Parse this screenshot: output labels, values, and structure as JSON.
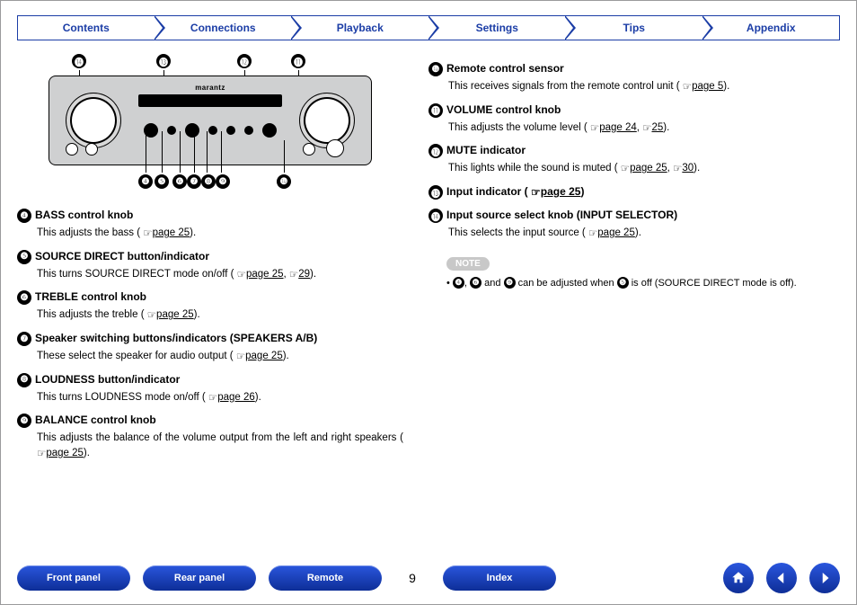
{
  "tabs": [
    "Contents",
    "Connections",
    "Playback",
    "Settings",
    "Tips",
    "Appendix"
  ],
  "callouts": {
    "top": [
      "⓮",
      "⓭",
      "⓬",
      "⓫"
    ],
    "bottom": [
      "❹",
      "❺",
      "❻",
      "❼",
      "❽",
      "❾",
      "❿"
    ]
  },
  "diagram": {
    "brand": "marantz"
  },
  "left": [
    {
      "num": "❹",
      "title": "BASS control knob",
      "body": "This adjusts the bass (",
      "links": [
        "page 25"
      ],
      "after": ")."
    },
    {
      "num": "❺",
      "title": "SOURCE DIRECT button/indicator",
      "body": "This turns SOURCE DIRECT mode on/off (",
      "links": [
        "page 25",
        "29"
      ],
      "after": ")."
    },
    {
      "num": "❻",
      "title": "TREBLE control knob",
      "body": "This adjusts the treble (",
      "links": [
        "page 25"
      ],
      "after": ")."
    },
    {
      "num": "❼",
      "title": "Speaker switching buttons/indicators (SPEAKERS A/B)",
      "body": "These select the speaker for audio output (",
      "links": [
        "page 25"
      ],
      "after": ")."
    },
    {
      "num": "❽",
      "title": "LOUDNESS button/indicator",
      "body": "This turns LOUDNESS mode on/off (",
      "links": [
        "page 26"
      ],
      "after": ")."
    },
    {
      "num": "❾",
      "title": "BALANCE control knob",
      "body": "This adjusts the balance of the volume output from the left and right speakers (",
      "links": [
        "page 25"
      ],
      "after": ")."
    }
  ],
  "right": [
    {
      "num": "❿",
      "title": "Remote control sensor",
      "body": "This receives signals from the remote control unit (",
      "links": [
        "page 5"
      ],
      "after": ")."
    },
    {
      "num": "⓫",
      "title": "VOLUME control knob",
      "body": "This adjusts the volume level (",
      "links": [
        "page 24",
        "25"
      ],
      "after": ")."
    },
    {
      "num": "⓬",
      "title": "MUTE indicator",
      "body": "This lights while the sound is muted (",
      "links": [
        "page 25",
        "30"
      ],
      "after": ")."
    },
    {
      "num": "⓭",
      "title": "Input indicator (",
      "body": "",
      "links": [
        "page 25"
      ],
      "after": ")",
      "titleHasLink": true
    },
    {
      "num": "⓮",
      "title": "Input source select knob (INPUT SELECTOR)",
      "body": "This selects the input source (",
      "links": [
        "page 25"
      ],
      "after": ")."
    }
  ],
  "noteLabel": "NOTE",
  "noteBullet": {
    "pre": "• ",
    "a": "❹",
    "b": "❻",
    "c": "❾",
    "d": "❺",
    "mid1": ", ",
    "mid2": " and ",
    "mid3": " can be adjusted when ",
    "mid4": " is off (SOURCE DIRECT mode is off)."
  },
  "pageNumber": "9",
  "bottomNav": {
    "front": "Front panel",
    "rear": "Rear panel",
    "remote": "Remote",
    "index": "Index"
  }
}
